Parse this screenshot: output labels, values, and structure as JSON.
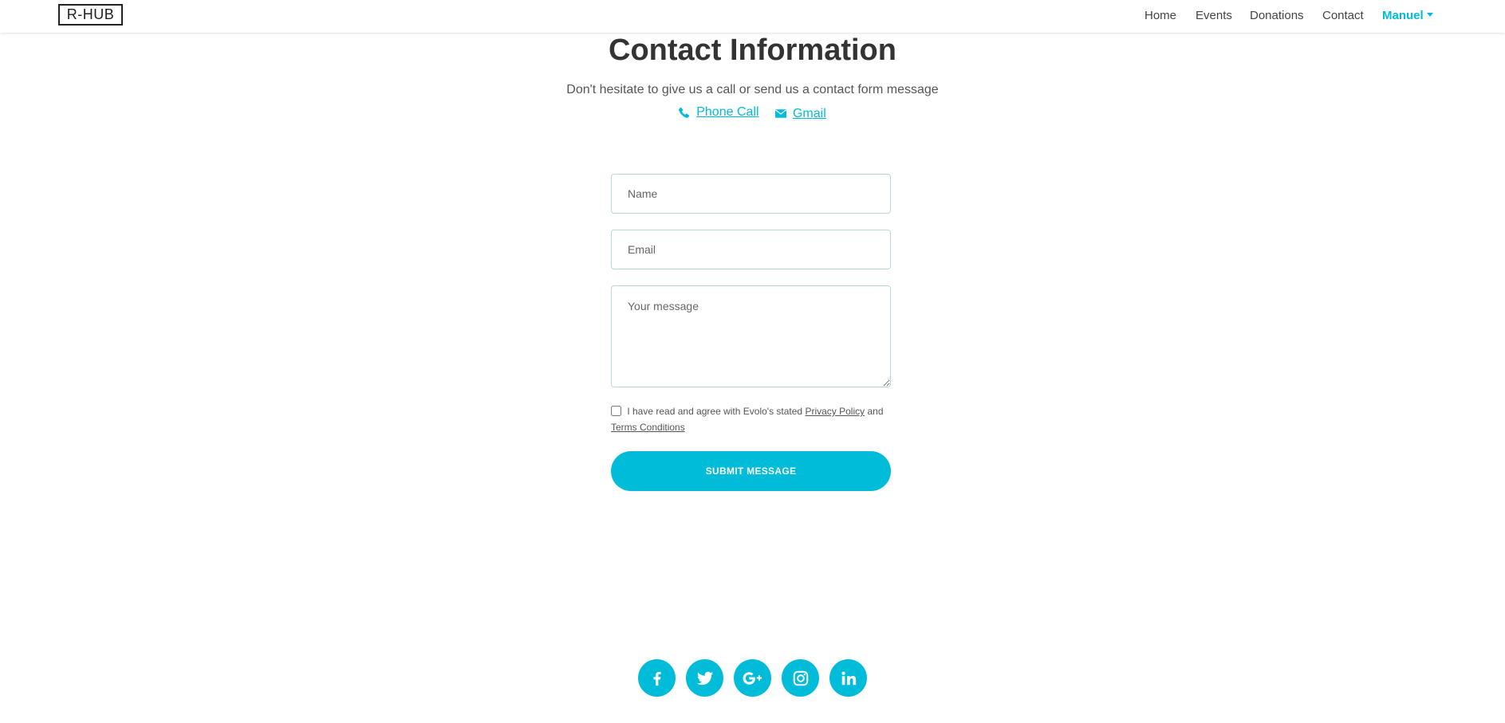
{
  "navbar": {
    "brand": "R-HUB",
    "links": [
      {
        "label": "Home"
      },
      {
        "label": "Events"
      },
      {
        "label": "Donations"
      },
      {
        "label": "Contact"
      },
      {
        "label": "Manuel",
        "active": true
      }
    ]
  },
  "contact": {
    "title": "Contact Information",
    "subtitle": "Don't hesitate to give us a call or send us a contact form message",
    "phone_label": "Phone Call",
    "email_label": "Gmail"
  },
  "form": {
    "name_placeholder": "Name",
    "email_placeholder": "Email",
    "message_placeholder": "Your message",
    "terms_text_1": "I have read and agree with Evolo's stated",
    "privacy_label": "Privacy Policy",
    "terms_text_2": "and",
    "terms_label": "Terms Conditions",
    "submit_label": "SUBMIT MESSAGE"
  },
  "social": {
    "icons": [
      "facebook-icon",
      "twitter-icon",
      "google-plus-icon",
      "instagram-icon",
      "linkedin-icon"
    ]
  },
  "colors": {
    "accent": "#00bcd9",
    "text": "#333333"
  }
}
